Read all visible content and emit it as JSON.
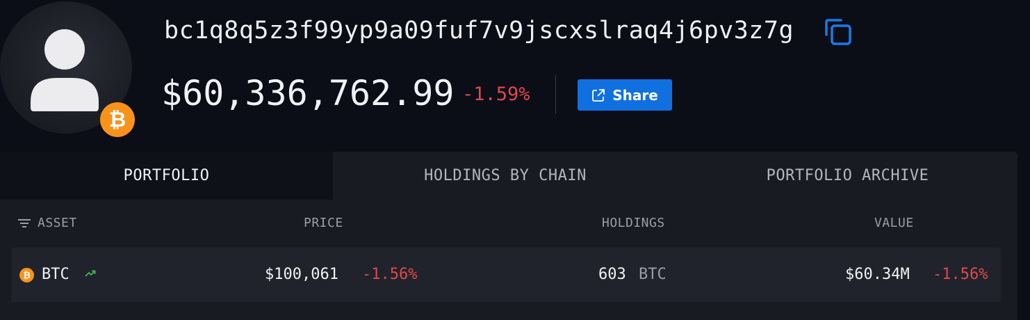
{
  "profile": {
    "address": "bc1q8q5z3f99yp9a09fuf7v9jscxslraq4j6pv3z7g",
    "balance": "$60,336,762.99",
    "balance_change": "-1.59%",
    "share_label": "Share",
    "badge_symbol": "₿"
  },
  "tabs": [
    {
      "label": "PORTFOLIO",
      "active": true
    },
    {
      "label": "HOLDINGS BY CHAIN",
      "active": false
    },
    {
      "label": "PORTFOLIO ARCHIVE",
      "active": false
    }
  ],
  "table": {
    "headers": {
      "asset": "ASSET",
      "price": "PRICE",
      "holdings": "HOLDINGS",
      "value": "VALUE"
    },
    "rows": [
      {
        "icon_symbol": "₿",
        "asset": "BTC",
        "price": "$100,061",
        "price_change": "-1.56%",
        "holdings_amount": "603",
        "holdings_unit": "BTC",
        "value": "$60.34M",
        "value_change": "-1.56%"
      }
    ]
  },
  "colors": {
    "background": "#0b0e17",
    "panel": "#191b22",
    "accent": "#1170e0",
    "negative": "#e0484d",
    "positive": "#3fb950",
    "bitcoin": "#f7931a"
  }
}
